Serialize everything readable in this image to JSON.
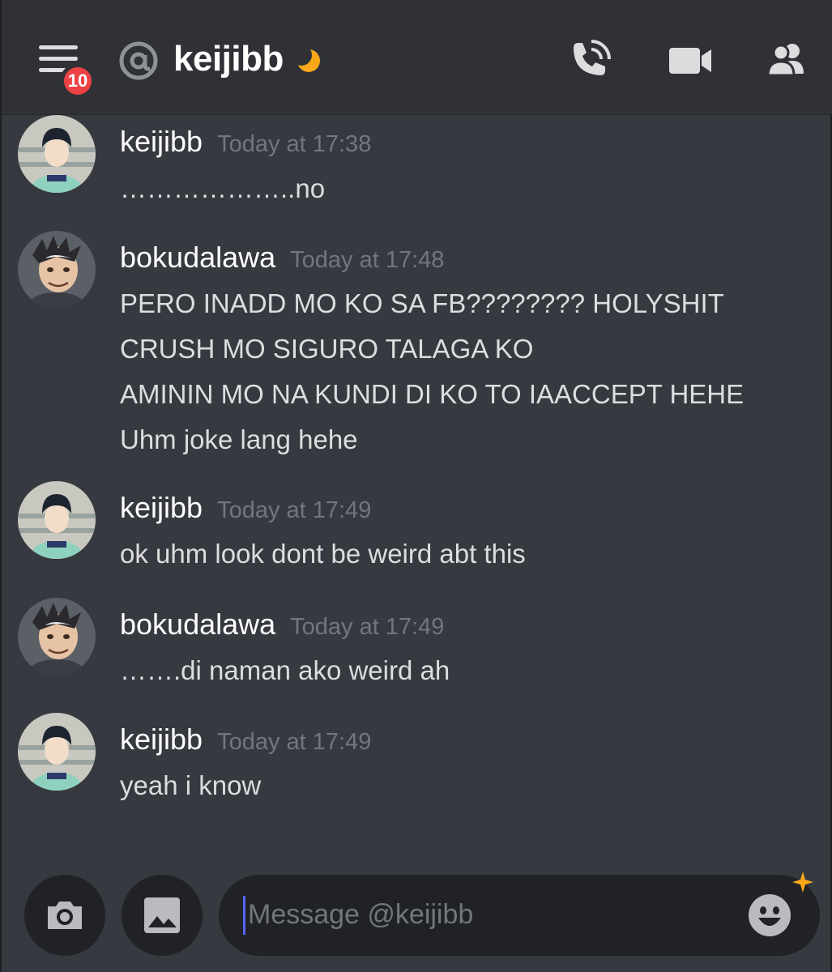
{
  "header": {
    "badge_count": "10",
    "title": "keijibb",
    "icons": [
      "menu-icon",
      "at-icon",
      "moon-icon",
      "call-icon",
      "video-icon",
      "members-icon"
    ]
  },
  "messages": [
    {
      "username": "keijibb",
      "timestamp": "Today at 17:38",
      "lines": [
        "………………..no"
      ]
    },
    {
      "username": "bokudalawa",
      "timestamp": "Today at 17:48",
      "lines": [
        "PERO INADD MO KO SA FB???????? HOLYSHIT",
        "CRUSH MO SIGURO TALAGA KO",
        "AMININ MO NA KUNDI DI KO TO IAACCEPT HEHE",
        "Uhm joke lang hehe"
      ]
    },
    {
      "username": "keijibb",
      "timestamp": "Today at 17:49",
      "lines": [
        "ok uhm look dont be weird abt this"
      ]
    },
    {
      "username": "bokudalawa",
      "timestamp": "Today at 17:49",
      "lines": [
        "…….di naman ako weird ah"
      ]
    },
    {
      "username": "keijibb",
      "timestamp": "Today at 17:49",
      "lines": [
        "yeah i know"
      ]
    }
  ],
  "composer": {
    "placeholder": "Message @keijibb",
    "icons": [
      "camera-icon",
      "image-icon",
      "emoji-icon",
      "sparkle-icon"
    ]
  },
  "colors": {
    "background": "#36393f",
    "header": "#2f3136",
    "input": "#202225",
    "badge": "#ed4245",
    "moon": "#faa81a",
    "caret": "#5865f2"
  }
}
